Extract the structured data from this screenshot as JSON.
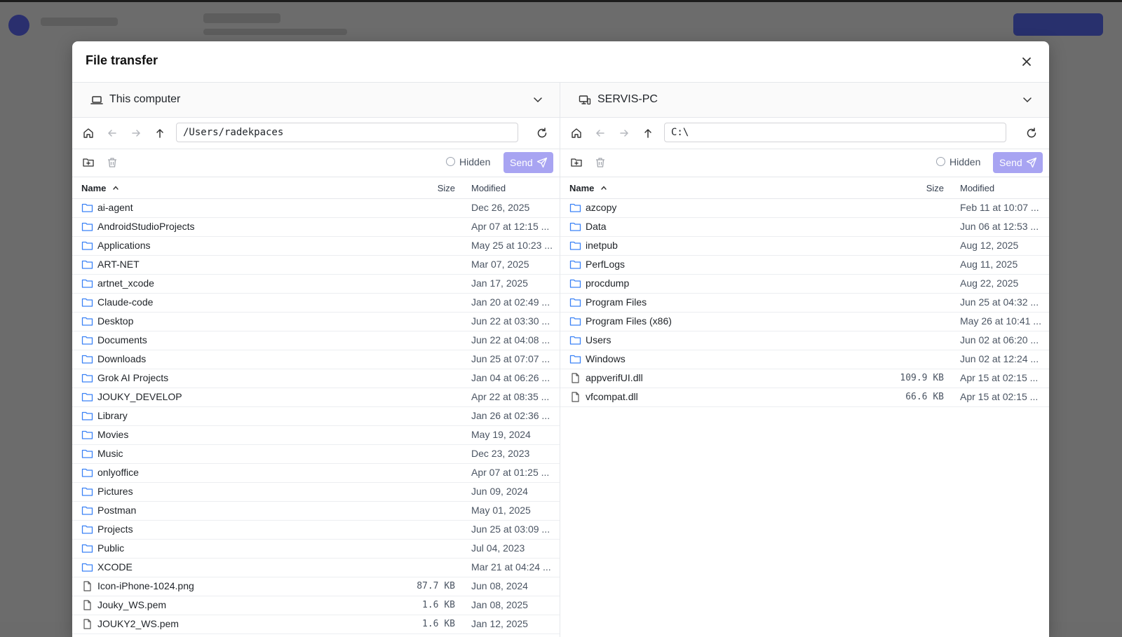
{
  "dialog": {
    "title": "File transfer"
  },
  "left": {
    "machine": "This computer",
    "path": "/Users/radekpaces",
    "hidden_label": "Hidden",
    "send_label": "Send",
    "columns": {
      "name": "Name",
      "size": "Size",
      "modified": "Modified"
    },
    "rows": [
      {
        "type": "folder",
        "name": "ai-agent",
        "size": "",
        "modified": "Dec 26, 2025"
      },
      {
        "type": "folder",
        "name": "AndroidStudioProjects",
        "size": "",
        "modified": "Apr 07 at 12:15 ..."
      },
      {
        "type": "folder",
        "name": "Applications",
        "size": "",
        "modified": "May 25 at 10:23 ..."
      },
      {
        "type": "folder",
        "name": "ART-NET",
        "size": "",
        "modified": "Mar 07, 2025"
      },
      {
        "type": "folder",
        "name": "artnet_xcode",
        "size": "",
        "modified": "Jan 17, 2025"
      },
      {
        "type": "folder",
        "name": "Claude-code",
        "size": "",
        "modified": "Jan 20 at 02:49 ..."
      },
      {
        "type": "folder",
        "name": "Desktop",
        "size": "",
        "modified": "Jun 22 at 03:30 ..."
      },
      {
        "type": "folder",
        "name": "Documents",
        "size": "",
        "modified": "Jun 22 at 04:08 ..."
      },
      {
        "type": "folder",
        "name": "Downloads",
        "size": "",
        "modified": "Jun 25 at 07:07 ..."
      },
      {
        "type": "folder",
        "name": "Grok AI Projects",
        "size": "",
        "modified": "Jan 04 at 06:26 ..."
      },
      {
        "type": "folder",
        "name": "JOUKY_DEVELOP",
        "size": "",
        "modified": "Apr 22 at 08:35 ..."
      },
      {
        "type": "folder",
        "name": "Library",
        "size": "",
        "modified": "Jan 26 at 02:36 ..."
      },
      {
        "type": "folder",
        "name": "Movies",
        "size": "",
        "modified": "May 19, 2024"
      },
      {
        "type": "folder",
        "name": "Music",
        "size": "",
        "modified": "Dec 23, 2023"
      },
      {
        "type": "folder",
        "name": "onlyoffice",
        "size": "",
        "modified": "Apr 07 at 01:25 ..."
      },
      {
        "type": "folder",
        "name": "Pictures",
        "size": "",
        "modified": "Jun 09, 2024"
      },
      {
        "type": "folder",
        "name": "Postman",
        "size": "",
        "modified": "May 01, 2025"
      },
      {
        "type": "folder",
        "name": "Projects",
        "size": "",
        "modified": "Jun 25 at 03:09 ..."
      },
      {
        "type": "folder",
        "name": "Public",
        "size": "",
        "modified": "Jul 04, 2023"
      },
      {
        "type": "folder",
        "name": "XCODE",
        "size": "",
        "modified": "Mar 21 at 04:24 ..."
      },
      {
        "type": "file",
        "name": "Icon-iPhone-1024.png",
        "size": "87.7 KB",
        "modified": "Jun 08, 2024"
      },
      {
        "type": "file",
        "name": "Jouky_WS.pem",
        "size": "1.6 KB",
        "modified": "Jan 08, 2025"
      },
      {
        "type": "file",
        "name": "JOUKY2_WS.pem",
        "size": "1.6 KB",
        "modified": "Jan 12, 2025"
      }
    ]
  },
  "right": {
    "machine": "SERVIS-PC",
    "path": "C:\\",
    "hidden_label": "Hidden",
    "send_label": "Send",
    "columns": {
      "name": "Name",
      "size": "Size",
      "modified": "Modified"
    },
    "rows": [
      {
        "type": "folder",
        "name": "azcopy",
        "size": "",
        "modified": "Feb 11 at 10:07 ..."
      },
      {
        "type": "folder",
        "name": "Data",
        "size": "",
        "modified": "Jun 06 at 12:53 ..."
      },
      {
        "type": "folder",
        "name": "inetpub",
        "size": "",
        "modified": "Aug 12, 2025"
      },
      {
        "type": "folder",
        "name": "PerfLogs",
        "size": "",
        "modified": "Aug 11, 2025"
      },
      {
        "type": "folder",
        "name": "procdump",
        "size": "",
        "modified": "Aug 22, 2025"
      },
      {
        "type": "folder",
        "name": "Program Files",
        "size": "",
        "modified": "Jun 25 at 04:32 ..."
      },
      {
        "type": "folder",
        "name": "Program Files (x86)",
        "size": "",
        "modified": "May 26 at 10:41 ..."
      },
      {
        "type": "folder",
        "name": "Users",
        "size": "",
        "modified": "Jun 02 at 06:20 ..."
      },
      {
        "type": "folder",
        "name": "Windows",
        "size": "",
        "modified": "Jun 02 at 12:24 ..."
      },
      {
        "type": "file",
        "name": "appverifUI.dll",
        "size": "109.9 KB",
        "modified": "Apr 15 at 02:15 ..."
      },
      {
        "type": "file",
        "name": "vfcompat.dll",
        "size": "66.6 KB",
        "modified": "Apr 15 at 02:15 ..."
      }
    ]
  },
  "icons": {
    "folder": "folder-icon",
    "file": "file-icon",
    "accent": "#a8a4f2",
    "folder_color": "#3b82f6"
  }
}
